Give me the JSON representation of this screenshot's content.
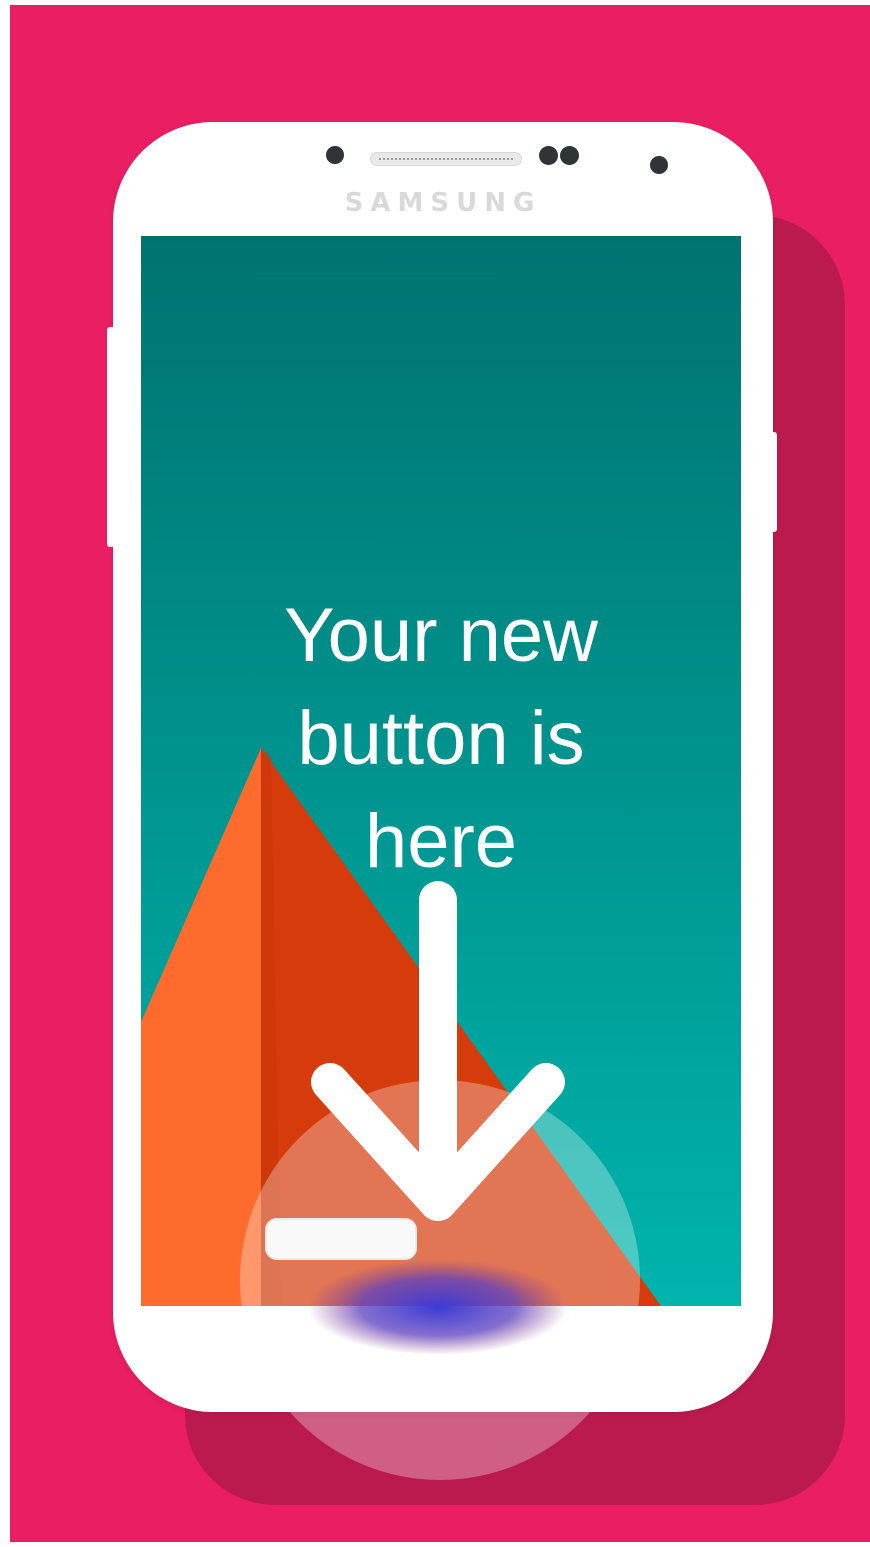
{
  "device": {
    "brand": "SAMSUNG"
  },
  "screen": {
    "headline_line1": "Your new",
    "headline_line2": "button is",
    "headline_line3": "here"
  },
  "colors": {
    "background": "#e91e63",
    "shadow": "#bb1a4f",
    "phone_body": "#ffffff",
    "screen_top": "#007370",
    "screen_bottom": "#00b4ad",
    "pyramid_light": "#ff6a2d",
    "pyramid_dark": "#d63b0b"
  },
  "icons": {
    "hint_arrow": "arrow-down-icon",
    "touch_indicator": "touch-ripple"
  }
}
